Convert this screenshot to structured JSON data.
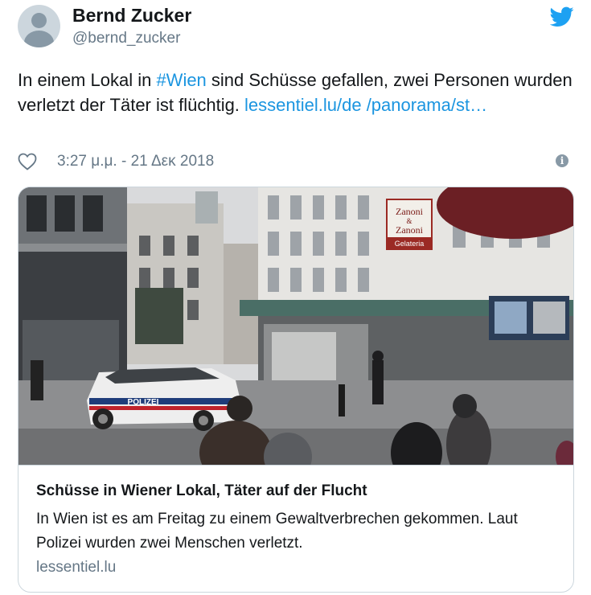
{
  "user": {
    "display_name": "Bernd Zucker",
    "handle": "@bernd_zucker"
  },
  "tweet": {
    "text_part1": "In einem Lokal in ",
    "hashtag": "#Wien",
    "text_part2": " sind Schüsse gefallen, zwei Personen wurden verletzt der Täter ist flüchtig. ",
    "link": "lessentiel.lu/de /panorama/st…",
    "timestamp": "3:27 μ.μ. - 21 Δεκ 2018"
  },
  "card": {
    "title": "Schüsse in Wiener Lokal, Täter auf der Flucht",
    "description": "In Wien ist es am Freitag zu einem Gewaltverbrechen gekommen. Laut Polizei wurden zwei Menschen verletzt.",
    "domain": "lessentiel.lu",
    "photo_sign_text": {
      "police_car": "POLIZEI",
      "shop_sign_line1": "Zanoni",
      "shop_sign_line2": "&",
      "shop_sign_line3": "Zanoni",
      "shop_sign_line4": "Gelateria"
    }
  },
  "icons": {
    "twitter": "twitter-bird-icon",
    "like": "heart-icon",
    "info": "info-icon",
    "avatar": "default-avatar-icon"
  },
  "colors": {
    "link": "#1b95e0",
    "secondary_text": "#657786",
    "border": "#ccd6dd"
  }
}
